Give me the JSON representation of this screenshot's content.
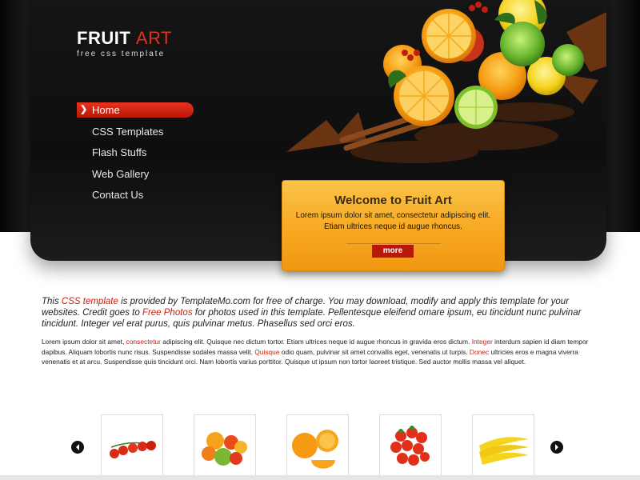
{
  "logo": {
    "title_main": "FRUIT",
    "title_accent": "ART",
    "tagline": "free css template"
  },
  "nav": {
    "items": [
      {
        "label": "Home",
        "active": true
      },
      {
        "label": "CSS Templates"
      },
      {
        "label": "Flash Stuffs"
      },
      {
        "label": "Web Gallery"
      },
      {
        "label": "Contact Us"
      }
    ]
  },
  "welcome": {
    "title": "Welcome to Fruit Art",
    "text": "Lorem ipsum dolor sit amet, consectetur adipiscing elit. Etiam ultrices neque id augue rhoncus.",
    "button": "more"
  },
  "intro": {
    "p1": "This ",
    "link1": "CSS template",
    "p2": " is provided by TemplateMo.com for free of charge. You may download, modify and apply this template for your websites. Credit goes to ",
    "link2": "Free Photos",
    "p3": " for photos used in this template. Pellentesque eleifend omare ipsum, eu tincidunt nunc pulvinar tincidunt. Integer vel erat purus, quis pulvinar metus. Phasellus sed orci eros."
  },
  "body": {
    "p1": "Lorem ipsum dolor sit amet, ",
    "link1": "consectetur",
    "p2": " adipiscing elit. Quisque nec dictum tortor. Etiam ultrices neque id augue rhoncus in gravida eros dictum. ",
    "link2": "Integer",
    "p3": " interdum sapien id diam tempor dapibus. Aliquam lobortis nunc risus. Suspendisse sodales massa velit. ",
    "link3": "Quisque",
    "p4": " odio quam, pulvinar sit amet convallis eget, venenatis ut turpis. ",
    "link4": "Donec",
    "p5": " ultricies eros e magna viverra venenatis et at arcu. Suspendisse quis tincidunt orci. Nam lobortis varius porttitor. Quisque ut ipsum non tortor laoreet tristique. Sed auctor mollis massa vel aliquet."
  },
  "gallery": {
    "items": [
      {
        "name": "tomatoes"
      },
      {
        "name": "mixed-fruits"
      },
      {
        "name": "oranges"
      },
      {
        "name": "strawberries"
      },
      {
        "name": "bananas"
      }
    ]
  },
  "colors": {
    "accent": "#c8210d",
    "welcome_bg": "#f7a922",
    "header_bg": "#0e0e0e"
  }
}
